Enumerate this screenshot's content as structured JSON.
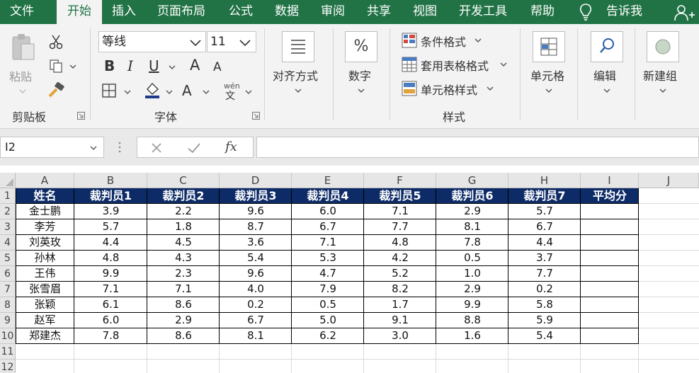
{
  "menu": {
    "tabs": [
      "文件",
      "开始",
      "插入",
      "页面布局",
      "公式",
      "数据",
      "审阅",
      "共享",
      "视图",
      "开发工具",
      "帮助"
    ],
    "active_tab": "开始",
    "tell_me": "告诉我"
  },
  "ribbon": {
    "clipboard": {
      "paste": "粘贴",
      "group": "剪贴板"
    },
    "font": {
      "font_name": "等线",
      "font_size": "11",
      "bold": "B",
      "italic": "I",
      "underline": "U",
      "grow": "A",
      "shrink": "A",
      "font_color": "A",
      "phonetic_top": "wén",
      "phonetic_bottom": "文",
      "group": "字体"
    },
    "alignment": {
      "label": "对齐方式"
    },
    "number": {
      "label": "数字",
      "symbol": "%"
    },
    "styles": {
      "conditional": "条件格式",
      "table_format": "套用表格格式",
      "cell_style": "单元格样式",
      "group": "样式"
    },
    "cells": {
      "label": "单元格"
    },
    "editing": {
      "label": "编辑"
    },
    "new_group": {
      "label": "新建组"
    }
  },
  "formula_bar": {
    "name_box": "I2",
    "fx": "fx",
    "content": ""
  },
  "sheet": {
    "columns": [
      "A",
      "B",
      "C",
      "D",
      "E",
      "F",
      "G",
      "H",
      "I",
      "J"
    ],
    "rows": [
      "1",
      "2",
      "3",
      "4",
      "5",
      "6",
      "7",
      "8",
      "9",
      "10",
      "11",
      "12"
    ],
    "header": [
      "姓名",
      "裁判员1",
      "裁判员2",
      "裁判员3",
      "裁判员4",
      "裁判员5",
      "裁判员6",
      "裁判员7",
      "平均分"
    ],
    "data": [
      [
        "金士鹏",
        "3.9",
        "2.2",
        "9.6",
        "6.0",
        "7.1",
        "2.9",
        "5.7",
        ""
      ],
      [
        "李芳",
        "5.7",
        "1.8",
        "8.7",
        "6.7",
        "7.7",
        "8.1",
        "6.7",
        ""
      ],
      [
        "刘英玫",
        "4.4",
        "4.5",
        "3.6",
        "7.1",
        "4.8",
        "7.8",
        "4.4",
        ""
      ],
      [
        "孙林",
        "4.8",
        "4.3",
        "5.4",
        "5.3",
        "4.2",
        "0.5",
        "3.7",
        ""
      ],
      [
        "王伟",
        "9.9",
        "2.3",
        "9.6",
        "4.7",
        "5.2",
        "1.0",
        "7.7",
        ""
      ],
      [
        "张雪眉",
        "7.1",
        "7.1",
        "4.0",
        "7.9",
        "8.2",
        "2.9",
        "0.2",
        ""
      ],
      [
        "张颖",
        "6.1",
        "8.6",
        "0.2",
        "0.5",
        "1.7",
        "9.9",
        "5.8",
        ""
      ],
      [
        "赵军",
        "6.0",
        "2.9",
        "6.7",
        "5.0",
        "9.1",
        "8.8",
        "5.9",
        ""
      ],
      [
        "郑建杰",
        "7.8",
        "8.6",
        "8.1",
        "6.2",
        "3.0",
        "1.6",
        "5.4",
        ""
      ]
    ],
    "header_fill": "#0d2b66"
  },
  "colors": {
    "brand": "#217346",
    "ribbon_bg": "#f3f3f3"
  }
}
